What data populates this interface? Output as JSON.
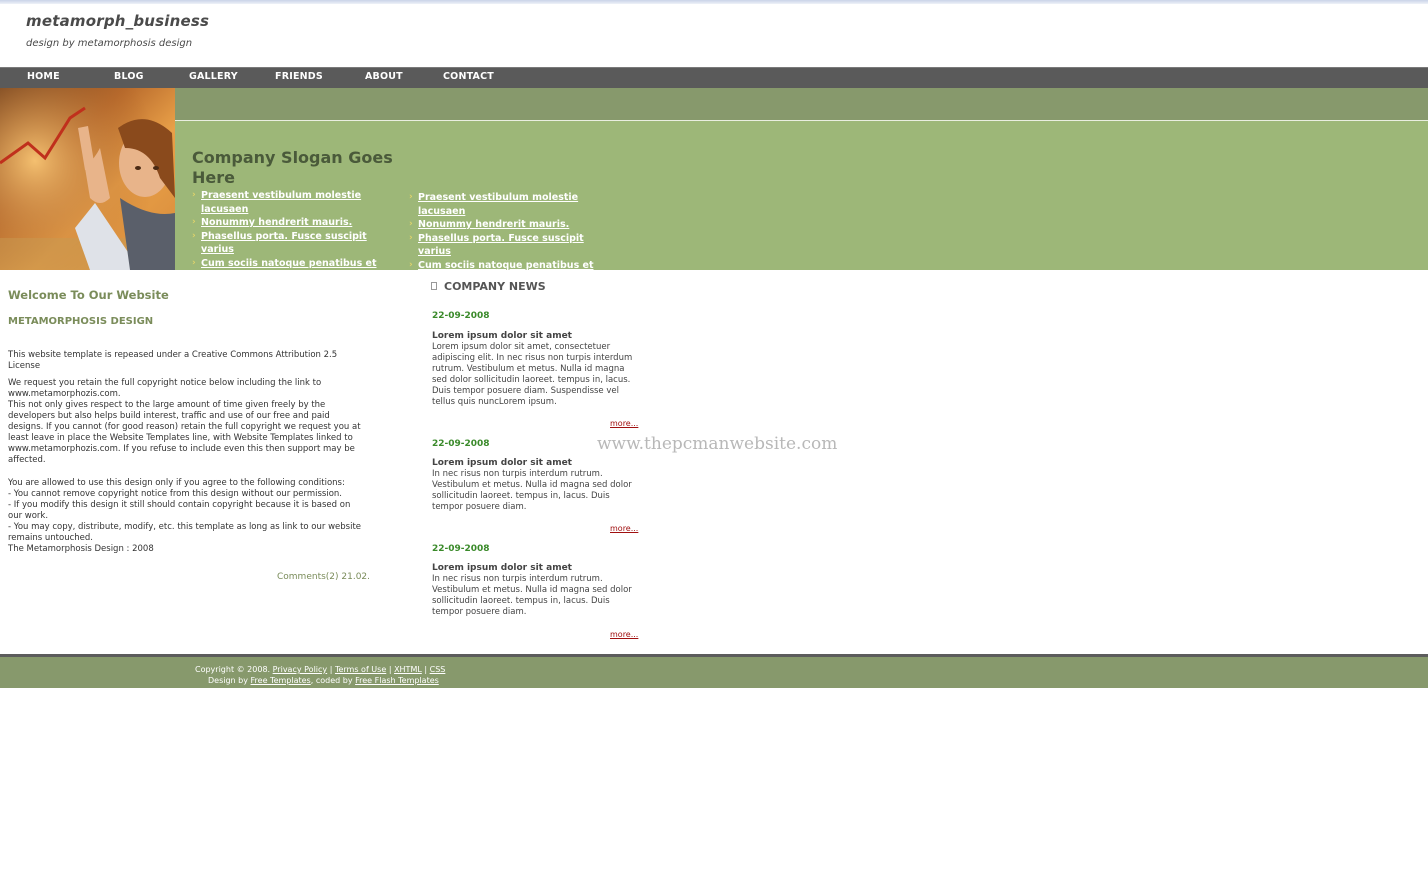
{
  "header": {
    "title": "metamorph_business",
    "subtitle": "design by metamorphosis design"
  },
  "nav": {
    "items": [
      {
        "label": "HOME"
      },
      {
        "label": "BLOG"
      },
      {
        "label": "GALLERY"
      },
      {
        "label": "FRIENDS"
      },
      {
        "label": "ABOUT"
      },
      {
        "label": "CONTACT"
      }
    ]
  },
  "banner": {
    "slogan": "Company Slogan Goes Here",
    "list_left": [
      "Praesent vestibulum molestie lacusaen",
      "Nonummy hendrerit mauris.",
      "Phasellus porta. Fusce suscipit varius",
      "Cum sociis natoque penatibus et magnis"
    ],
    "list_right": [
      "Praesent vestibulum molestie lacusaen",
      "Nonummy hendrerit mauris.",
      "Phasellus porta. Fusce suscipit varius",
      "Cum sociis natoque penatibus et magnis"
    ],
    "bullet": "›"
  },
  "main": {
    "welcome_heading": "Welcome To Our Website",
    "sub_heading": "METAMORPHOSIS DESIGN",
    "para1": "This website template is repeased under a Creative Commons Attribution 2.5 License",
    "para2": "We request you retain the full copyright notice below including the link to www.metamorphozis.com.\nThis not only gives respect to the large amount of time given freely by the developers but also helps build interest, traffic and use of our free and paid designs. If you cannot (for good reason) retain the full copyright we request you at least leave in place the Website Templates line, with Website Templates linked to www.metamorphozis.com. If you refuse to include even this then support may be affected.",
    "para3": "You are allowed to use this design only if you agree to the following conditions:\n- You cannot remove copyright notice from this design without our permission.\n- If you modify this design it still should contain copyright because it is based on our work.\n- You may copy, distribute, modify, etc. this template as long as link to our website remains untouched.\nThe Metamorphosis Design : 2008",
    "comments": "Comments(2) 21.02."
  },
  "news": {
    "heading": "COMPANY NEWS",
    "items": [
      {
        "date": "22-09-2008",
        "title": "Lorem ipsum dolor sit amet",
        "body": "Lorem ipsum dolor sit amet, consectetuer adipiscing elit. In nec risus non turpis interdum rutrum. Vestibulum et metus. Nulla id magna sed dolor sollicitudin laoreet. tempus in, lacus. Duis tempor posuere diam. Suspendisse vel tellus quis nuncLorem ipsum.",
        "more": "more..."
      },
      {
        "date": "22-09-2008",
        "title": "Lorem ipsum dolor sit amet",
        "body": "In nec risus non turpis interdum rutrum. Vestibulum et metus. Nulla id magna sed dolor sollicitudin laoreet. tempus in, lacus. Duis tempor posuere diam.",
        "more": "more..."
      },
      {
        "date": "22-09-2008",
        "title": "Lorem ipsum dolor sit amet",
        "body": "In nec risus non turpis interdum rutrum. Vestibulum et metus. Nulla id magna sed dolor sollicitudin laoreet. tempus in, lacus. Duis tempor posuere diam.",
        "more": "more..."
      }
    ]
  },
  "watermark": "www.thepcmanwebsite.com",
  "footer": {
    "copyright": "Copyright © 2008.",
    "privacy": "Privacy Policy",
    "terms": "Terms of Use",
    "xhtml": "XHTML",
    "css": "CSS",
    "sep": "|",
    "design_by": "Design by",
    "free_templates": "Free Templates",
    "coded_by": ", coded by",
    "free_flash": "Free Flash Templates"
  },
  "colors": {
    "banner_green": "#9db778",
    "strip_green": "#87996c",
    "nav_gray": "#5a5a5a",
    "heading_green": "#7a8c5a",
    "date_green": "#3a8a2a",
    "more_red": "#a01010"
  }
}
